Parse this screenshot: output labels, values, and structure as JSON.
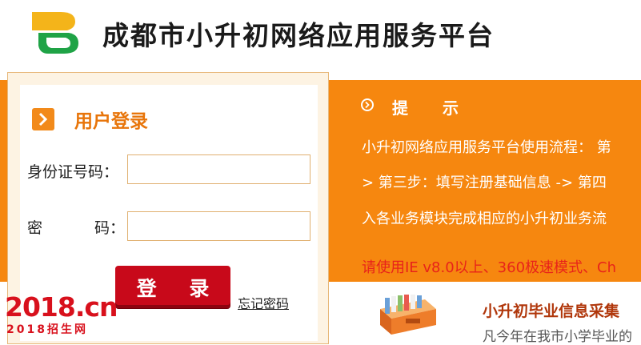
{
  "header": {
    "site_title": "成都市小升初网络应用服务平台"
  },
  "login": {
    "title": "用户登录",
    "id_label": "身份证号码：",
    "password_label_part1": "密",
    "password_label_part2": "码：",
    "id_value": "",
    "password_value": "",
    "login_button": "登 录",
    "forgot_link": "忘记密码"
  },
  "tips": {
    "title": "提 示",
    "line1": "小升初网络应用服务平台使用流程：  第",
    "line2": "> 第三步：填写注册基础信息 -> 第四",
    "line3": "入各业务模块完成相应的小升初业务流",
    "warning": "请使用IE v8.0以上、360极速模式、Ch"
  },
  "collect": {
    "title": "小升初毕业信息采集",
    "description": "凡今年在我市小学毕业的"
  },
  "watermark": {
    "big": "2018.cn",
    "small": "2018招生网"
  },
  "colors": {
    "brand_orange": "#f6870f",
    "login_red": "#c8091a",
    "title_orange": "#e8750a"
  }
}
